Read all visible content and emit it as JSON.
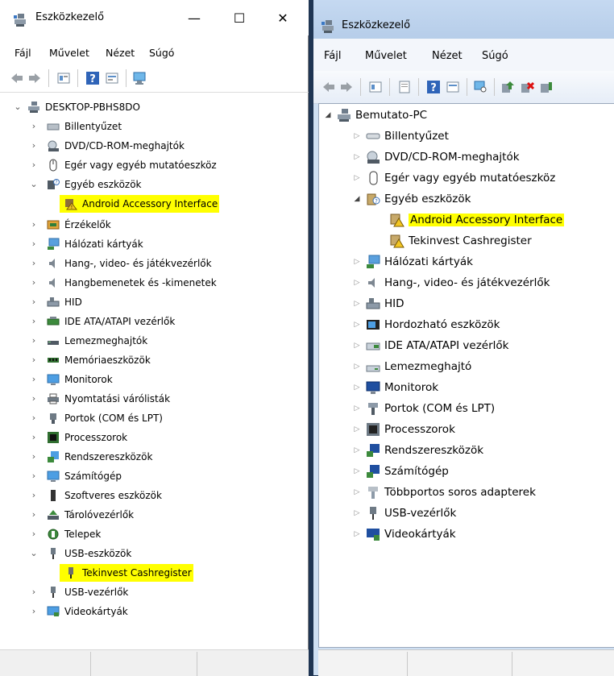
{
  "left_window": {
    "title": "Eszközkezelő",
    "caption_buttons": {
      "minimize": "—",
      "maximize": "☐",
      "close": "✕"
    },
    "menu": [
      "Fájl",
      "Művelet",
      "Nézet",
      "Súgó"
    ],
    "tree": [
      {
        "label": "DESKTOP-PBHS8DO",
        "state": "expanded",
        "level": 0,
        "icon": "computer-icon"
      },
      {
        "label": "Billentyűzet",
        "state": "collapsed",
        "level": 1,
        "icon": "keyboard-icon"
      },
      {
        "label": "DVD/CD-ROM-meghajtók",
        "state": "collapsed",
        "level": 1,
        "icon": "dvd-drive-icon"
      },
      {
        "label": "Egér vagy egyéb mutatóeszköz",
        "state": "collapsed",
        "level": 1,
        "icon": "mouse-icon"
      },
      {
        "label": "Egyéb eszközök",
        "state": "expanded",
        "level": 1,
        "icon": "unknown-device-icon"
      },
      {
        "label": "Android Accessory Interface",
        "state": "leaf",
        "level": 2,
        "icon": "warning-device-icon",
        "highlight": true
      },
      {
        "label": "Érzékelők",
        "state": "collapsed",
        "level": 1,
        "icon": "sensor-icon"
      },
      {
        "label": "Hálózati kártyák",
        "state": "collapsed",
        "level": 1,
        "icon": "network-adapter-icon"
      },
      {
        "label": "Hang-, video- és játékvezérlők",
        "state": "collapsed",
        "level": 1,
        "icon": "speaker-icon"
      },
      {
        "label": "Hangbemenetek és -kimenetek",
        "state": "collapsed",
        "level": 1,
        "icon": "speaker-icon"
      },
      {
        "label": "HID",
        "state": "collapsed",
        "level": 1,
        "icon": "hid-icon"
      },
      {
        "label": "IDE ATA/ATAPI vezérlők",
        "state": "collapsed",
        "level": 1,
        "icon": "ide-controller-icon"
      },
      {
        "label": "Lemezmeghajtók",
        "state": "collapsed",
        "level": 1,
        "icon": "disk-drive-icon"
      },
      {
        "label": "Memóriaeszközök",
        "state": "collapsed",
        "level": 1,
        "icon": "memory-icon"
      },
      {
        "label": "Monitorok",
        "state": "collapsed",
        "level": 1,
        "icon": "monitor-icon"
      },
      {
        "label": "Nyomtatási várólisták",
        "state": "collapsed",
        "level": 1,
        "icon": "printer-icon"
      },
      {
        "label": "Portok (COM és LPT)",
        "state": "collapsed",
        "level": 1,
        "icon": "port-icon"
      },
      {
        "label": "Processzorok",
        "state": "collapsed",
        "level": 1,
        "icon": "processor-icon"
      },
      {
        "label": "Rendszereszközök",
        "state": "collapsed",
        "level": 1,
        "icon": "system-device-icon"
      },
      {
        "label": "Számítógép",
        "state": "collapsed",
        "level": 1,
        "icon": "monitor-icon"
      },
      {
        "label": "Szoftveres eszközök",
        "state": "collapsed",
        "level": 1,
        "icon": "software-device-icon"
      },
      {
        "label": "Tárolóvezérlők",
        "state": "collapsed",
        "level": 1,
        "icon": "storage-controller-icon"
      },
      {
        "label": "Telepek",
        "state": "collapsed",
        "level": 1,
        "icon": "battery-icon"
      },
      {
        "label": "USB-eszközök",
        "state": "expanded",
        "level": 1,
        "icon": "usb-icon"
      },
      {
        "label": "Tekinvest Cashregister",
        "state": "leaf",
        "level": 2,
        "icon": "usb-device-icon",
        "highlight": true
      },
      {
        "label": "USB-vezérlők",
        "state": "collapsed",
        "level": 1,
        "icon": "usb-icon"
      },
      {
        "label": "Videokártyák",
        "state": "collapsed",
        "level": 1,
        "icon": "display-adapter-icon"
      }
    ]
  },
  "right_window": {
    "title": "Eszközkezelő",
    "menu": [
      "Fájl",
      "Művelet",
      "Nézet",
      "Súgó"
    ],
    "tree": [
      {
        "label": "Bemutato-PC",
        "state": "expanded",
        "level": 0,
        "icon": "computer-icon"
      },
      {
        "label": "Billentyűzet",
        "state": "collapsed",
        "level": 1,
        "icon": "keyboard-icon"
      },
      {
        "label": "DVD/CD-ROM-meghajtók",
        "state": "collapsed",
        "level": 1,
        "icon": "dvd-drive-icon"
      },
      {
        "label": "Egér vagy egyéb mutatóeszköz",
        "state": "collapsed",
        "level": 1,
        "icon": "mouse-icon"
      },
      {
        "label": "Egyéb eszközök",
        "state": "expanded",
        "level": 1,
        "icon": "unknown-device-icon"
      },
      {
        "label": "Android Accessory Interface",
        "state": "leaf",
        "level": 2,
        "icon": "warning-device-icon",
        "highlight": true
      },
      {
        "label": "Tekinvest Cashregister",
        "state": "leaf",
        "level": 2,
        "icon": "warning-device-icon"
      },
      {
        "label": "Hálózati kártyák",
        "state": "collapsed",
        "level": 1,
        "icon": "network-adapter-icon"
      },
      {
        "label": "Hang-, video- és játékvezérlők",
        "state": "collapsed",
        "level": 1,
        "icon": "speaker-icon"
      },
      {
        "label": "HID",
        "state": "collapsed",
        "level": 1,
        "icon": "hid-icon"
      },
      {
        "label": "Hordozható eszközök",
        "state": "collapsed",
        "level": 1,
        "icon": "portable-device-icon"
      },
      {
        "label": "IDE ATA/ATAPI vezérlők",
        "state": "collapsed",
        "level": 1,
        "icon": "ide-controller-icon"
      },
      {
        "label": "Lemezmeghajtó",
        "state": "collapsed",
        "level": 1,
        "icon": "disk-drive-icon"
      },
      {
        "label": "Monitorok",
        "state": "collapsed",
        "level": 1,
        "icon": "monitor-icon"
      },
      {
        "label": "Portok (COM és LPT)",
        "state": "collapsed",
        "level": 1,
        "icon": "port-icon"
      },
      {
        "label": "Processzorok",
        "state": "collapsed",
        "level": 1,
        "icon": "processor-icon"
      },
      {
        "label": "Rendszereszközök",
        "state": "collapsed",
        "level": 1,
        "icon": "system-device-icon"
      },
      {
        "label": "Számítógép",
        "state": "collapsed",
        "level": 1,
        "icon": "monitor-icon"
      },
      {
        "label": "Többportos soros adapterek",
        "state": "collapsed",
        "level": 1,
        "icon": "serial-adapter-icon"
      },
      {
        "label": "USB-vezérlők",
        "state": "collapsed",
        "level": 1,
        "icon": "usb-icon"
      },
      {
        "label": "Videokártyák",
        "state": "collapsed",
        "level": 1,
        "icon": "display-adapter-icon"
      }
    ]
  },
  "colors": {
    "highlight": "#ffff00",
    "left_bg": "#ffffff",
    "right_frame": "#cfe0f3"
  }
}
